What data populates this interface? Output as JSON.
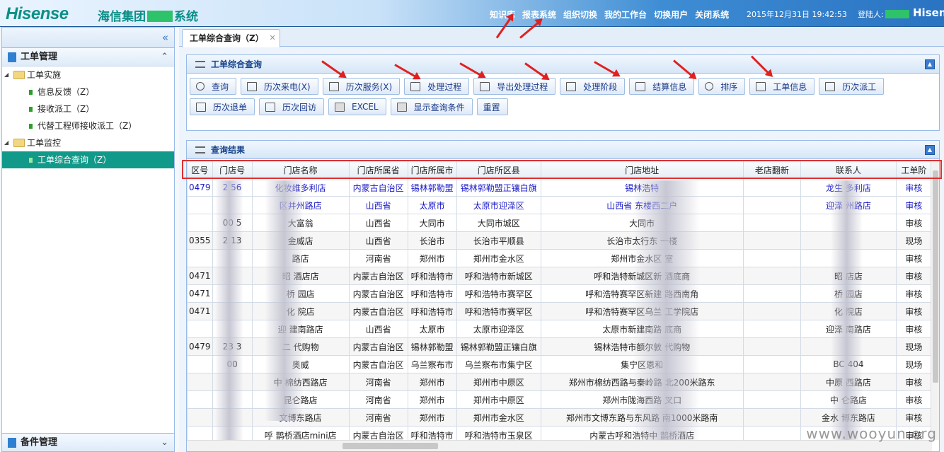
{
  "header": {
    "logo": "Hisense",
    "system_name_prefix": "海信集团",
    "system_name_suffix": "系统",
    "nav": [
      "知识库",
      "报表系统",
      "组织切换",
      "我的工作台",
      "切换用户",
      "关闭系统"
    ],
    "datetime": "2015年12月31日 19:42:53",
    "login_label_prefix": "登陆人:",
    "login_name": "Hisen"
  },
  "sidebar": {
    "collapse_glyph": "«",
    "section_title": "工单管理",
    "groups": [
      {
        "label": "工单实施",
        "items": [
          "信息反馈（Z）",
          "接收派工（Z）",
          "代替工程师接收派工（Z）"
        ]
      },
      {
        "label": "工单监控",
        "items": [
          "工单综合查询（Z）"
        ]
      }
    ],
    "bottom_section": "备件管理"
  },
  "tabs": [
    {
      "label": "工单综合查询（Z）"
    }
  ],
  "query_panel": {
    "title": "工单综合查询",
    "buttons": [
      {
        "label": "查询",
        "icon": "search-icon"
      },
      {
        "label": "历次来电(X)",
        "icon": "edit-icon"
      },
      {
        "label": "历次服务(X)",
        "icon": "edit-icon"
      },
      {
        "label": "处理过程",
        "icon": "edit-icon"
      },
      {
        "label": "导出处理过程",
        "icon": "edit-icon"
      },
      {
        "label": "处理阶段",
        "icon": "edit-icon"
      },
      {
        "label": "结算信息",
        "icon": "edit-icon"
      },
      {
        "label": "排序",
        "icon": "search-icon"
      },
      {
        "label": "工单信息",
        "icon": "edit-icon"
      },
      {
        "label": "历次派工",
        "icon": "edit-icon"
      },
      {
        "label": "历次退单",
        "icon": "edit-icon"
      },
      {
        "label": "历次回访",
        "icon": "edit-icon"
      },
      {
        "label": "EXCEL",
        "icon": "excel-icon"
      },
      {
        "label": "显示查询条件",
        "icon": "excel-icon"
      },
      {
        "label": "重置",
        "icon": ""
      }
    ]
  },
  "result_panel": {
    "title": "查询结果",
    "columns": [
      "区号",
      "门店号",
      "门店名称",
      "门店所属省",
      "门店所属市",
      "门店所区县",
      "门店地址",
      "老店翻新",
      "联系人",
      "工单阶"
    ],
    "rows": [
      [
        "0479",
        "2   56",
        "化妆维多利店",
        "内蒙古自治区",
        "锡林郭勒盟",
        "锡林郭勒盟正镶白旗",
        "锡林浩特",
        "",
        "龙生    多利店",
        "审核"
      ],
      [
        "",
        "",
        "区并州路店",
        "山西省",
        "太原市",
        "太原市迎泽区",
        "山西省        东楼西二户",
        "",
        "迎泽    州路店",
        "审核"
      ],
      [
        "",
        "00   5",
        "大富翁",
        "山西省",
        "大同市",
        "大同市城区",
        "大同市",
        "",
        "",
        "审核"
      ],
      [
        "0355",
        "2   13",
        "金威店",
        "山西省",
        "长治市",
        "长治市平顺县",
        "长治市太行东        一楼",
        "",
        "",
        "现场"
      ],
      [
        "",
        "",
        "路店",
        "河南省",
        "郑州市",
        "郑州市金水区",
        "郑州市金水区        室",
        "",
        "",
        "审核"
      ],
      [
        "0471",
        "",
        "昭   酒店店",
        "内蒙古自治区",
        "呼和浩特市",
        "呼和浩特市新城区",
        "呼和浩特新城区新        酒底商",
        "",
        "昭   店店",
        "审核"
      ],
      [
        "0471",
        "",
        "桥   园店",
        "内蒙古自治区",
        "呼和浩特市",
        "呼和浩特市赛罕区",
        "呼和浩特赛罕区新建        路西南角",
        "",
        "桥   园店",
        "审核"
      ],
      [
        "0471",
        "",
        "化   院店",
        "内蒙古自治区",
        "呼和浩特市",
        "呼和浩特市赛罕区",
        "呼和浩特赛罕区乌兰        工学院店",
        "",
        "化   院店",
        "审核"
      ],
      [
        "",
        "",
        "迎   建南路店",
        "山西省",
        "太原市",
        "太原市迎泽区",
        "太原市新建南路        底商",
        "",
        "迎泽   南路店",
        "审核"
      ],
      [
        "0479",
        "23   3",
        "二   代购物",
        "内蒙古自治区",
        "锡林郭勒盟",
        "锡林郭勒盟正镶白旗",
        "锡林浩特市额尔敦        代购物",
        "",
        "",
        "现场"
      ],
      [
        "",
        "00",
        "奥威",
        "内蒙古自治区",
        "乌兰察布市",
        "乌兰察布市集宁区",
        "集宁区恩和",
        "",
        "BC   404",
        "现场"
      ],
      [
        "",
        "",
        "中   棉纺西路店",
        "河南省",
        "郑州市",
        "郑州市中原区",
        "郑州市棉纺西路与秦岭路        北200米路东",
        "",
        "中原   西路店",
        "审核"
      ],
      [
        "",
        "",
        "   昆仑路店",
        "河南省",
        "郑州市",
        "郑州市中原区",
        "郑州市陇海西路        叉口",
        "",
        "中   仑路店",
        "审核"
      ],
      [
        "",
        "",
        "   文博东路店",
        "河南省",
        "郑州市",
        "郑州市金水区",
        "郑州市文博东路与东风路        南1000米路南",
        "",
        "金水   博东路店",
        "审核"
      ],
      [
        "",
        "",
        "呼   鹊桥酒店mini店",
        "内蒙古自治区",
        "呼和浩特市",
        "呼和浩特市玉泉区",
        "内蒙古呼和浩特中        鹊桥酒店",
        "",
        "",
        "审核"
      ]
    ]
  },
  "watermark": "www.wooyun.org"
}
